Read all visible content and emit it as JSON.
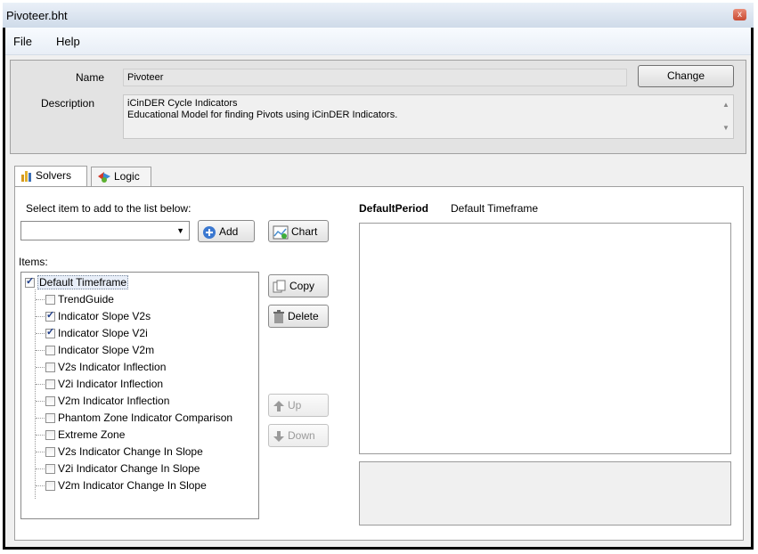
{
  "window": {
    "title": "Pivoteer.bht",
    "close_glyph": "x"
  },
  "menu": {
    "items": [
      "File",
      "Help"
    ]
  },
  "header": {
    "name_label": "Name",
    "name_value": "Pivoteer",
    "change_button": "Change",
    "description_label": "Description",
    "description_lines": [
      "iCinDER Cycle Indicators",
      "Educational Model for finding Pivots using iCinDER Indicators."
    ]
  },
  "tabs": [
    {
      "label": "Solvers",
      "icon": "bar-chart-icon",
      "active": true
    },
    {
      "label": "Logic",
      "icon": "logic-icon",
      "active": false
    }
  ],
  "solvers": {
    "select_label": "Select item to add to the list below:",
    "dropdown_value": "",
    "add_button": "Add",
    "chart_button": "Chart",
    "items_label": "Items:",
    "copy_button": "Copy",
    "delete_button": "Delete",
    "up_button": "Up",
    "down_button": "Down",
    "tree_root": {
      "label": "Default Timeframe",
      "checked": true
    },
    "tree_items": [
      {
        "label": "TrendGuide",
        "checked": false
      },
      {
        "label": "Indicator Slope V2s",
        "checked": true
      },
      {
        "label": "Indicator Slope V2i",
        "checked": true
      },
      {
        "label": "Indicator Slope V2m",
        "checked": false
      },
      {
        "label": "V2s Indicator Inflection",
        "checked": false
      },
      {
        "label": "V2i Indicator Inflection",
        "checked": false
      },
      {
        "label": "V2m Indicator Inflection",
        "checked": false
      },
      {
        "label": "Phantom Zone Indicator Comparison",
        "checked": false
      },
      {
        "label": "Extreme Zone",
        "checked": false
      },
      {
        "label": "V2s Indicator Change In Slope",
        "checked": false
      },
      {
        "label": "V2i Indicator Change In Slope",
        "checked": false
      },
      {
        "label": "V2m Indicator Change In Slope",
        "checked": false
      }
    ]
  },
  "details": {
    "period_title": "DefaultPeriod",
    "period_subtitle": "Default Timeframe"
  },
  "colors": {
    "accent": "#1c3c8a",
    "window_frame": "#000000",
    "panel_bg": "#f0f0f0"
  }
}
